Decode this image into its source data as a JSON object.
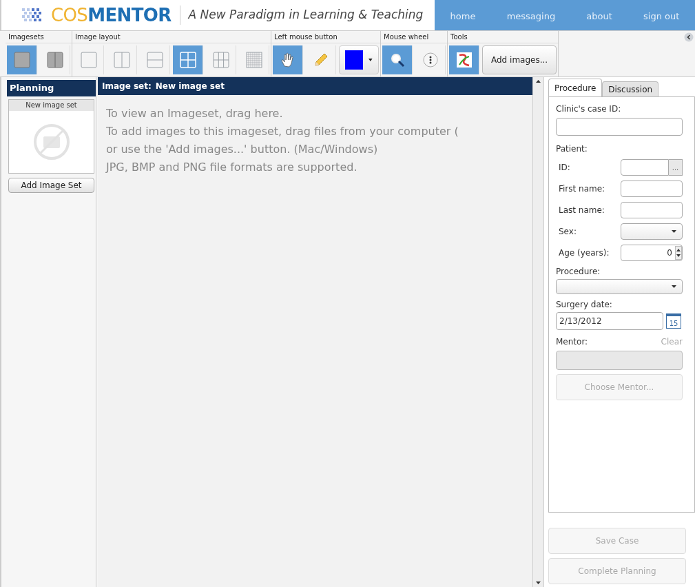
{
  "header": {
    "brand": {
      "first": "COS",
      "rest": "MENTOR"
    },
    "tagline": "A New Paradigm in Learning & Teaching",
    "nav": [
      "home",
      "messaging",
      "about",
      "sign out"
    ]
  },
  "toolbar": {
    "groups": [
      {
        "label": "Imagesets",
        "tools": [
          {
            "kind": "single-set",
            "selected": true
          },
          {
            "kind": "dual-set",
            "selected": false
          }
        ]
      },
      {
        "label": "Image layout",
        "tools": [
          {
            "kind": "layout-1",
            "selected": false
          },
          {
            "kind": "layout-cols",
            "selected": false
          },
          {
            "kind": "layout-rows",
            "selected": false
          },
          {
            "kind": "layout-2x2",
            "selected": true
          },
          {
            "kind": "layout-3x3",
            "selected": false
          },
          {
            "kind": "layout-grid",
            "selected": false
          }
        ]
      },
      {
        "label": "Left mouse button",
        "tools": [
          {
            "kind": "hand",
            "selected": true
          },
          {
            "kind": "pencil",
            "selected": false
          },
          {
            "kind": "color",
            "selected": false,
            "color": "#0000ff"
          }
        ]
      },
      {
        "label": "Mouse wheel",
        "tools": [
          {
            "kind": "zoom",
            "selected": true
          },
          {
            "kind": "scroll",
            "selected": false
          }
        ]
      },
      {
        "label": "Tools",
        "tools": [
          {
            "kind": "curve",
            "selected": true
          },
          {
            "kind": "button",
            "selected": false,
            "label": "Add images..."
          }
        ]
      }
    ]
  },
  "planning": {
    "title": "Planning",
    "card_title": "New image set",
    "add_button": "Add Image Set"
  },
  "viewer": {
    "label": "Image set:",
    "name": "New image set",
    "lines": [
      "To view an Imageset, drag here.",
      "To add images to this imageset, drag files from your computer (",
      "or use the 'Add images...' button. (Mac/Windows)",
      "JPG, BMP and PNG file formats are supported."
    ]
  },
  "tabs": [
    {
      "label": "Procedure",
      "selected": true
    },
    {
      "label": "Discussion",
      "selected": false
    }
  ],
  "form": {
    "case_id_label": "Clinic's case ID:",
    "patient_label": "Patient:",
    "patient_fields": [
      {
        "label": "ID:",
        "kind": "lookup",
        "button": "..."
      },
      {
        "label": "First name:",
        "kind": "text"
      },
      {
        "label": "Last name:",
        "kind": "text"
      },
      {
        "label": "Sex:",
        "kind": "select"
      },
      {
        "label": "Age (years):",
        "kind": "spinner",
        "value": "0"
      }
    ],
    "procedure_label": "Procedure:",
    "surgery_label": "Surgery date:",
    "surgery_value": "2/13/2012",
    "calendar_day": "15",
    "mentor_label": "Mentor:",
    "clear_link": "Clear",
    "mentor_disabled": true,
    "choose_button": {
      "label": "Choose Mentor...",
      "disabled": true
    }
  },
  "actions": [
    {
      "label": "Save Case",
      "disabled": true
    },
    {
      "label": "Complete Planning",
      "disabled": true
    }
  ]
}
